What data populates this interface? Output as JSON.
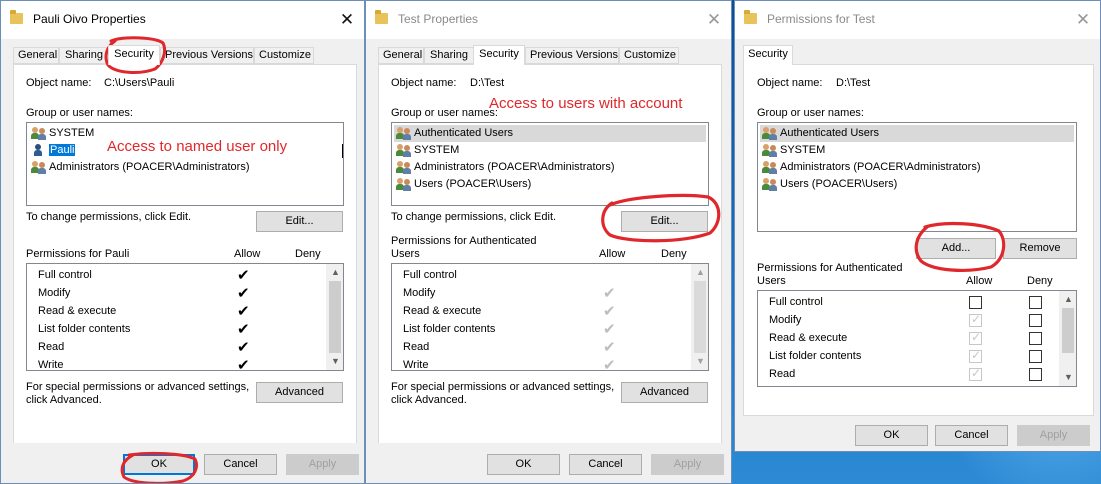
{
  "colors": {
    "annotation": "#e0282c",
    "selection": "#0078d7",
    "desktop": "#1565a8"
  },
  "dialog1": {
    "title": "Pauli Oivo Properties",
    "tabs": [
      "General",
      "Sharing",
      "Security",
      "Previous Versions",
      "Customize"
    ],
    "object_name_label": "Object name:",
    "object_name_value": "C:\\Users\\Pauli",
    "group_label": "Group or user names:",
    "users": [
      "SYSTEM",
      "Pauli",
      "Administrators (POACER\\Administrators)"
    ],
    "change_text": "To change permissions, click Edit.",
    "edit_label": "Edit...",
    "perms_for": "Permissions for Pauli",
    "allow": "Allow",
    "deny": "Deny",
    "permissions": [
      "Full control",
      "Modify",
      "Read & execute",
      "List folder contents",
      "Read",
      "Write"
    ],
    "special_text_1": "For special permissions or advanced settings,",
    "special_text_2": "click Advanced.",
    "advanced_label": "Advanced",
    "ok": "OK",
    "cancel": "Cancel",
    "apply": "Apply",
    "annotation": "Access to named user only"
  },
  "dialog2": {
    "title": "Test Properties",
    "tabs": [
      "General",
      "Sharing",
      "Security",
      "Previous Versions",
      "Customize"
    ],
    "object_name_label": "Object name:",
    "object_name_value": "D:\\Test",
    "group_label": "Group or user names:",
    "users": [
      "Authenticated Users",
      "SYSTEM",
      "Administrators (POACER\\Administrators)",
      "Users (POACER\\Users)"
    ],
    "change_text": "To change permissions, click Edit.",
    "edit_label": "Edit...",
    "perms_for_1": "Permissions for Authenticated",
    "perms_for_2": "Users",
    "allow": "Allow",
    "deny": "Deny",
    "permissions": [
      "Full control",
      "Modify",
      "Read & execute",
      "List folder contents",
      "Read",
      "Write"
    ],
    "special_text_1": "For special permissions or advanced settings,",
    "special_text_2": "click Advanced.",
    "advanced_label": "Advanced",
    "ok": "OK",
    "cancel": "Cancel",
    "apply": "Apply",
    "annotation": "Access to users with account"
  },
  "dialog3": {
    "title": "Permissions for Test",
    "tab": "Security",
    "object_name_label": "Object name:",
    "object_name_value": "D:\\Test",
    "group_label": "Group or user names:",
    "users": [
      "Authenticated Users",
      "SYSTEM",
      "Administrators (POACER\\Administrators)",
      "Users (POACER\\Users)"
    ],
    "add_label": "Add...",
    "remove_label": "Remove",
    "perms_for_1": "Permissions for Authenticated",
    "perms_for_2": "Users",
    "allow": "Allow",
    "deny": "Deny",
    "permissions": [
      "Full control",
      "Modify",
      "Read & execute",
      "List folder contents",
      "Read"
    ],
    "ok": "OK",
    "cancel": "Cancel",
    "apply": "Apply"
  }
}
